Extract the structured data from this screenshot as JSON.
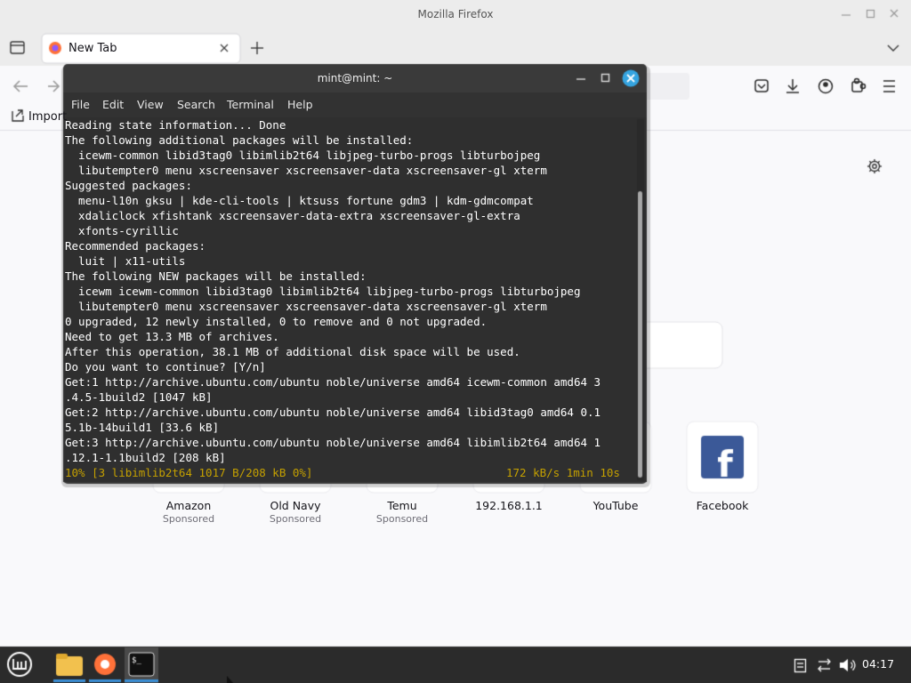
{
  "firefox": {
    "window_title": "Mozilla Firefox",
    "tab_label": "New Tab",
    "import_label": "Import",
    "shortcuts": [
      {
        "title": "Amazon",
        "subtitle": "Sponsored",
        "icon": "amazon-icon"
      },
      {
        "title": "Old Navy",
        "subtitle": "Sponsored",
        "icon": "old-navy-icon"
      },
      {
        "title": "Temu",
        "subtitle": "Sponsored",
        "icon": "temu-icon"
      },
      {
        "title": "192.168.1.1",
        "subtitle": "",
        "icon": "site-icon"
      },
      {
        "title": "YouTube",
        "subtitle": "",
        "icon": "youtube-icon"
      },
      {
        "title": "Facebook",
        "subtitle": "",
        "icon": "facebook-icon"
      }
    ]
  },
  "terminal": {
    "title": "mint@mint: ~",
    "menu": [
      "File",
      "Edit",
      "View",
      "Search",
      "Terminal",
      "Help"
    ],
    "lines": [
      "Reading state information... Done",
      "The following additional packages will be installed:",
      "  icewm-common libid3tag0 libimlib2t64 libjpeg-turbo-progs libturbojpeg",
      "  libutempter0 menu xscreensaver xscreensaver-data xscreensaver-gl xterm",
      "Suggested packages:",
      "  menu-l10n gksu | kde-cli-tools | ktsuss fortune gdm3 | kdm-gdmcompat",
      "  xdaliclock xfishtank xscreensaver-data-extra xscreensaver-gl-extra",
      "  xfonts-cyrillic",
      "Recommended packages:",
      "  luit | x11-utils",
      "The following NEW packages will be installed:",
      "  icewm icewm-common libid3tag0 libimlib2t64 libjpeg-turbo-progs libturbojpeg",
      "  libutempter0 menu xscreensaver xscreensaver-data xscreensaver-gl xterm",
      "0 upgraded, 12 newly installed, 0 to remove and 0 not upgraded.",
      "Need to get 13.3 MB of archives.",
      "After this operation, 38.1 MB of additional disk space will be used.",
      "Do you want to continue? [Y/n]",
      "Get:1 http://archive.ubuntu.com/ubuntu noble/universe amd64 icewm-common amd64 3",
      ".4.5-1build2 [1047 kB]",
      "Get:2 http://archive.ubuntu.com/ubuntu noble/universe amd64 libid3tag0 amd64 0.1",
      "5.1b-14build1 [33.6 kB]",
      "Get:3 http://archive.ubuntu.com/ubuntu noble/universe amd64 libimlib2t64 amd64 1",
      ".12.1-1.1build2 [208 kB]"
    ],
    "progress_left": "10% [3 libimlib2t64 1017 B/208 kB 0%]",
    "progress_right": "172 kB/s 1min 10s"
  },
  "taskbar": {
    "clock": "04:17",
    "apps": [
      "menu-icon",
      "files-icon",
      "firefox-icon",
      "terminal-icon"
    ]
  },
  "colors": {
    "terminal_bg": "#2f2f2f",
    "terminal_text": "#ffffff",
    "progress_text": "#c4a000",
    "taskbar_bg": "#2b2b2b",
    "close_accent": "#35a4e0",
    "facebook_blue": "#3b5998"
  }
}
